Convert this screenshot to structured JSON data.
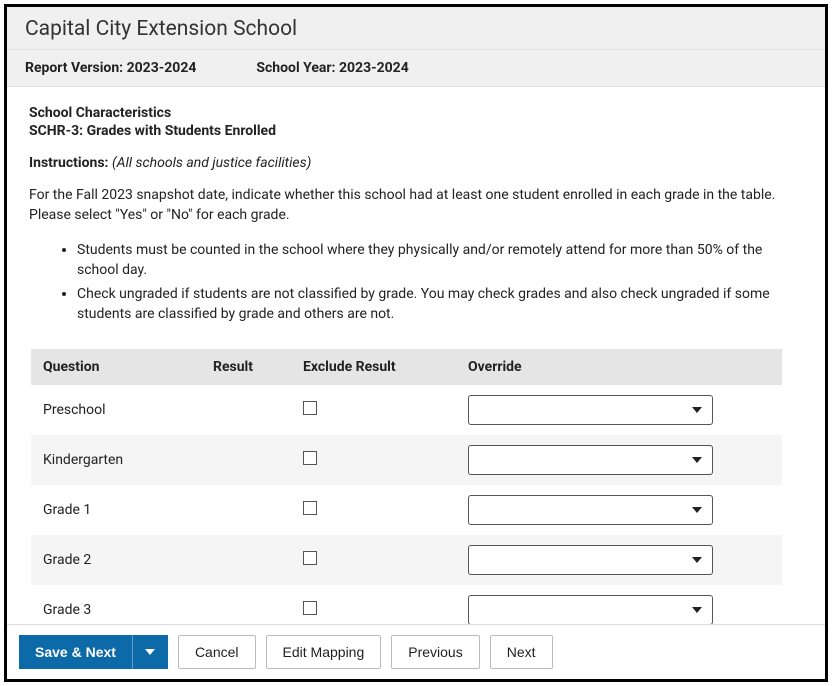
{
  "header": {
    "title": "Capital City Extension School"
  },
  "meta": {
    "report_version_label": "Report Version:",
    "report_version_value": "2023-2024",
    "school_year_label": "School Year:",
    "school_year_value": "2023-2024"
  },
  "section": {
    "category": "School Characteristics",
    "code_title": "SCHR-3: Grades with Students Enrolled",
    "instructions_label": "Instructions:",
    "instructions_note": "(All schools and justice facilities)",
    "paragraph": "For the Fall 2023 snapshot date, indicate whether this school had at least one student enrolled in each grade in the table. Please select \"Yes\" or \"No\" for each grade.",
    "bullets": [
      "Students must be counted in the school where they physically and/or remotely attend for more than 50% of the school day.",
      "Check ungraded if students are not classified by grade. You may check grades and also check ungraded if some students are classified by grade and others are not."
    ]
  },
  "table": {
    "headers": {
      "question": "Question",
      "result": "Result",
      "exclude": "Exclude Result",
      "override": "Override"
    },
    "rows": [
      {
        "question": "Preschool",
        "result": "",
        "exclude": false,
        "override": ""
      },
      {
        "question": "Kindergarten",
        "result": "",
        "exclude": false,
        "override": ""
      },
      {
        "question": "Grade 1",
        "result": "",
        "exclude": false,
        "override": ""
      },
      {
        "question": "Grade 2",
        "result": "",
        "exclude": false,
        "override": ""
      },
      {
        "question": "Grade 3",
        "result": "",
        "exclude": false,
        "override": ""
      }
    ]
  },
  "footer": {
    "save_next": "Save & Next",
    "cancel": "Cancel",
    "edit_mapping": "Edit Mapping",
    "previous": "Previous",
    "next": "Next"
  }
}
